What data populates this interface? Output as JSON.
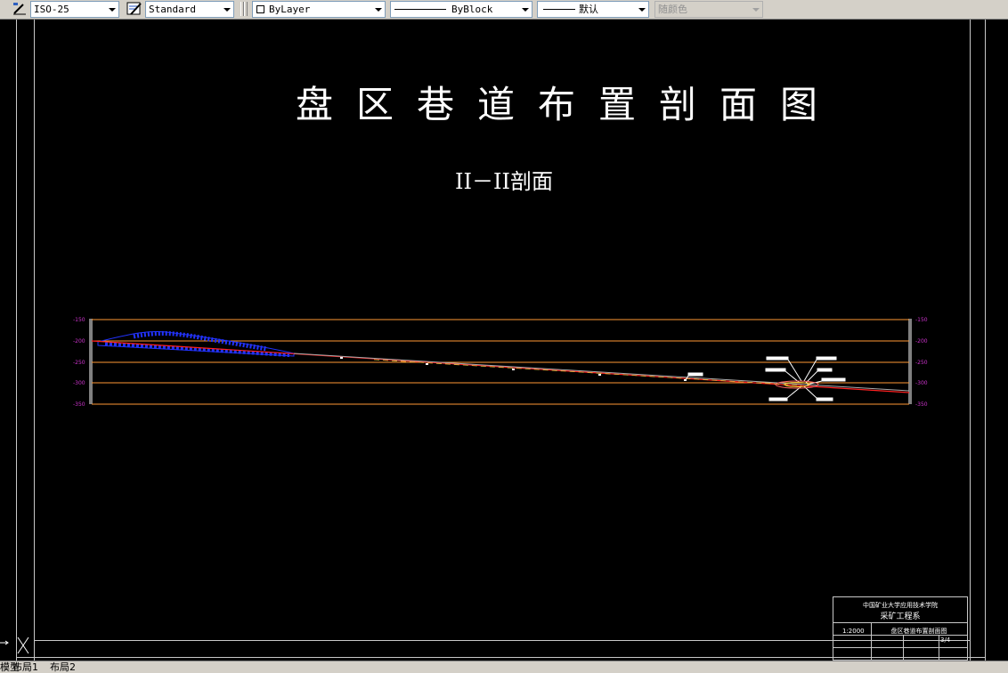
{
  "toolbar": {
    "dimstyle": {
      "value": "ISO-25",
      "icon": "dimension-style-icon"
    },
    "textstyle": {
      "value": "Standard",
      "icon": "text-style-icon"
    },
    "color": {
      "value": "ByLayer"
    },
    "linetype": {
      "value": "ByBlock"
    },
    "lineweight": {
      "value": "默认"
    },
    "plotstyle": {
      "value": "随颜色"
    }
  },
  "drawing": {
    "title": "盘区巷道布置剖面图",
    "subtitle": "II－II剖面",
    "elevation_labels_left": [
      "-150",
      "-200",
      "-250",
      "-300",
      "-350"
    ],
    "elevation_labels_right": [
      "-150",
      "-200",
      "-250",
      "-300",
      "-350"
    ],
    "colors": {
      "background": "#000000",
      "grid": "#ff9933",
      "elevation_text": "#cc33cc",
      "coal_seam": "#ff2020",
      "goaf_hatch": "#2233ff",
      "border": "#c8c8c8"
    }
  },
  "title_block": {
    "school": "中国矿业大学应用技术学院",
    "department": "采矿工程系",
    "drawing_name": "盘区巷道布置剖面图",
    "scale": "1:2000",
    "sheet": "3/4  "
  },
  "layout_tabs": [
    "模型",
    "布局1",
    "布局2"
  ]
}
